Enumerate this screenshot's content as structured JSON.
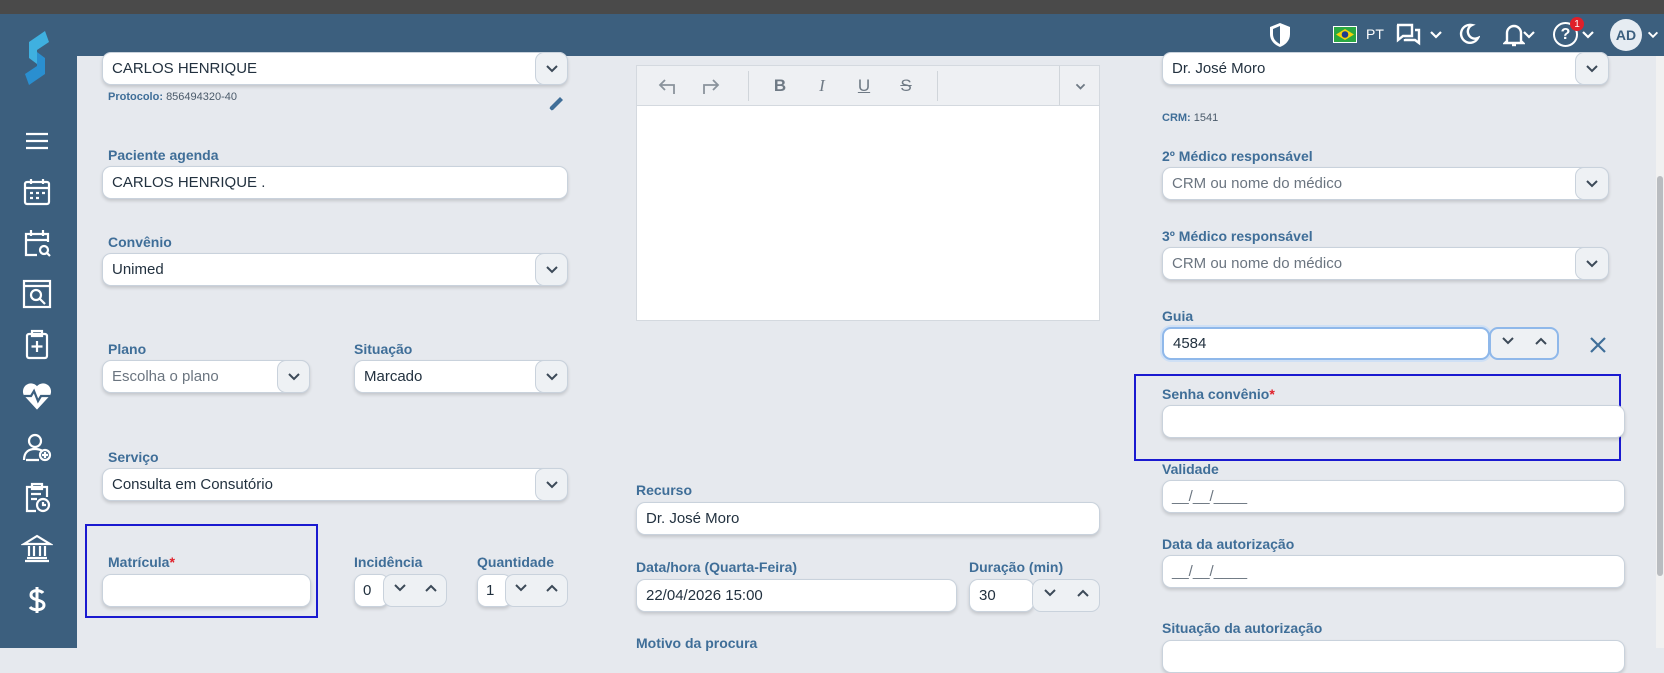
{
  "topbar": {
    "language": "PT",
    "notifications_count": "1",
    "avatar_initials": "AD"
  },
  "colors": {
    "sidebar": "#3c5f7e",
    "label": "#3f6e98",
    "required": "#e0202a",
    "highlight": "#1a1ad0"
  },
  "sidebar": {
    "icons": [
      "logo-icon",
      "menu-icon",
      "calendar-icon",
      "calendar-search-icon",
      "search-window-icon",
      "clipboard-plus-icon",
      "heart-pulse-icon",
      "user-plus-icon",
      "clipboard-clock-icon",
      "bank-icon",
      "dollar-icon"
    ]
  },
  "left": {
    "patient_value": "CARLOS HENRIQUE",
    "protocolo_label": "Protocolo:",
    "protocolo_value": "856494320-40",
    "paciente_agenda_label": "Paciente agenda",
    "paciente_agenda_value": "CARLOS HENRIQUE .",
    "convenio_label": "Convênio",
    "convenio_value": "Unimed",
    "plano_label": "Plano",
    "plano_placeholder": "Escolha o plano",
    "situacao_label": "Situação",
    "situacao_value": "Marcado",
    "servico_label": "Serviço",
    "servico_value": "Consulta em Consutório",
    "matricula_label": "Matrícula",
    "incidencia_label": "Incidência",
    "incidencia_value": "0",
    "quantidade_label": "Quantidade",
    "quantidade_value": "1"
  },
  "middle": {
    "editor_tools": [
      "undo",
      "redo",
      "bold",
      "italic",
      "underline",
      "strikethrough",
      "more"
    ],
    "bold": "B",
    "italic": "I",
    "underline": "U",
    "strike": "S",
    "recurso_label": "Recurso",
    "recurso_value": "Dr. José Moro",
    "datahora_label": "Data/hora (Quarta-Feira)",
    "datahora_value": "22/04/2026 15:00",
    "duracao_label": "Duração (min)",
    "duracao_value": "30",
    "motivo_label": "Motivo da procura"
  },
  "right": {
    "medico_value": "Dr. José Moro",
    "crm_label": "CRM:",
    "crm_value": "1541",
    "medico2_label": "2º Médico responsável",
    "medico3_label": "3º Médico responsável",
    "medico_placeholder": "CRM ou nome do médico",
    "guia_label": "Guia",
    "guia_value": "4584",
    "senha_label": "Senha convênio",
    "validade_label": "Validade",
    "validade_placeholder": "__/__/____",
    "data_aut_label": "Data da autorização",
    "data_aut_placeholder": "__/__/____",
    "situacao_aut_label": "Situação da autorização"
  }
}
